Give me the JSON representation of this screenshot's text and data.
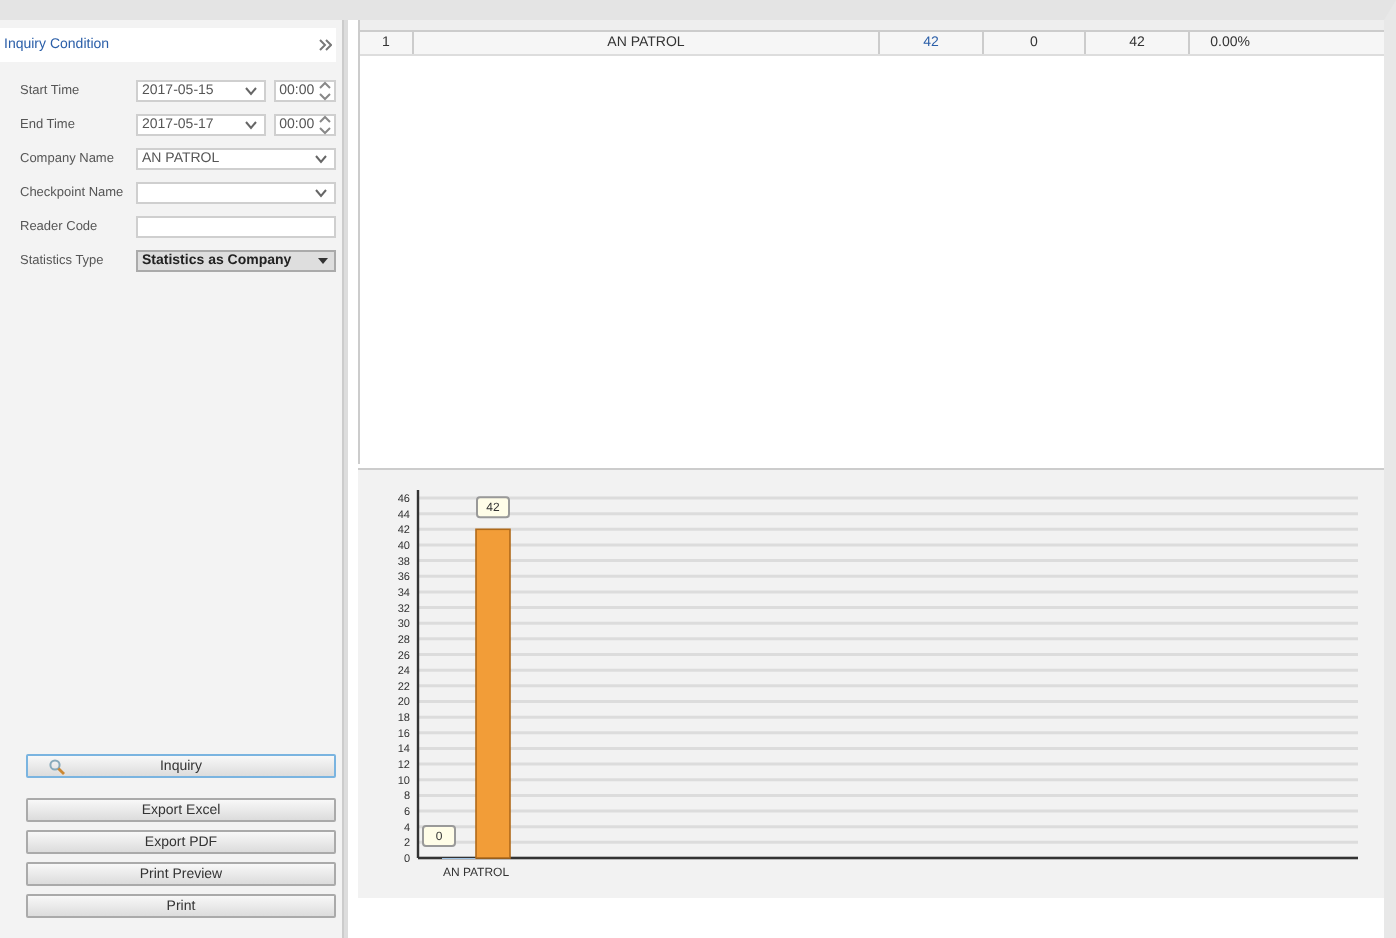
{
  "inquiry_panel": {
    "title": "Inquiry Condition",
    "fields": [
      {
        "kind": "datetime",
        "label": "Start Time",
        "value": "2017-05-15",
        "time": "00:00"
      },
      {
        "kind": "datetime",
        "label": "End Time",
        "value": "2017-05-17",
        "time": "00:00"
      },
      {
        "kind": "dropdown",
        "label": "Company Name",
        "value": "AN PATROL"
      },
      {
        "kind": "dropdown",
        "label": "Checkpoint Name"
      },
      {
        "kind": "text",
        "label": "Reader Code"
      },
      {
        "kind": "select",
        "label": "Statistics Type",
        "value": "Statistics as Company"
      }
    ],
    "inquiry_button": "Inquiry",
    "buttons": [
      "Export Excel",
      "Export PDF",
      "Print Preview",
      "Print"
    ]
  },
  "table": {
    "rows": [
      {
        "no": "1",
        "content": "AN PATROL",
        "plan": "42",
        "arrived": "0",
        "unarrived": "42",
        "rate": "0.00%"
      }
    ]
  },
  "chart": {
    "chart_data": {
      "type": "bar",
      "categories": [
        "AN PATROL"
      ],
      "series": [
        {
          "color": "#9fc3e6",
          "values": [
            0
          ]
        },
        {
          "color": "#f29d38",
          "values": [
            42
          ]
        }
      ],
      "grid": true,
      "ylim": [
        0,
        46
      ],
      "yticks": [
        0,
        2,
        4,
        6,
        8,
        10,
        12,
        14,
        16,
        18,
        20,
        22,
        24,
        26,
        28,
        30,
        32,
        34,
        36,
        38,
        40,
        42,
        44,
        46
      ],
      "data_labels": true
    }
  }
}
